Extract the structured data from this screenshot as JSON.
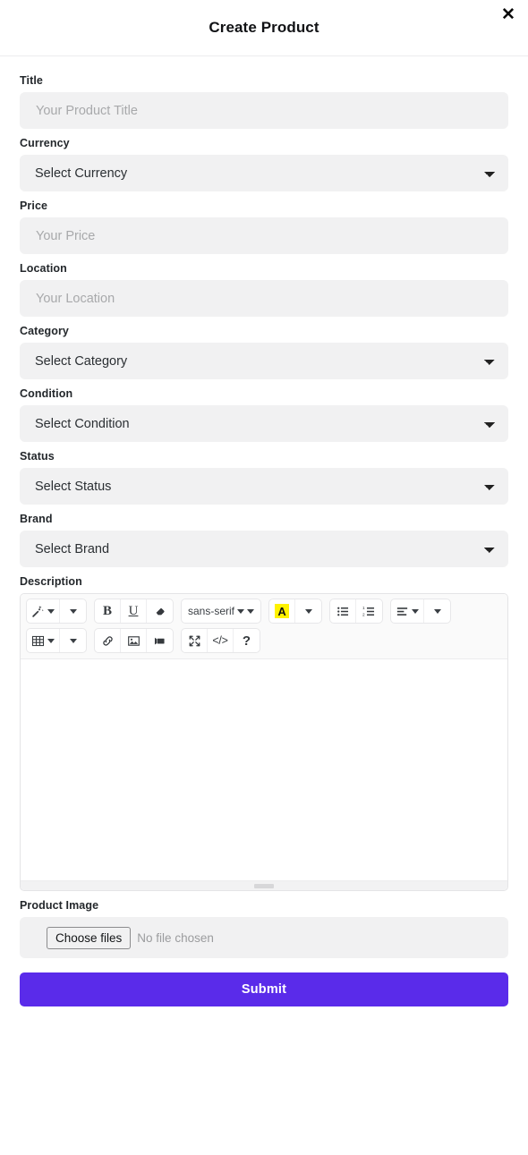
{
  "header": {
    "title": "Create Product",
    "close_label": "✕"
  },
  "form": {
    "fields": [
      {
        "label": "Title",
        "type": "text",
        "placeholder": "Your Product Title",
        "value": ""
      },
      {
        "label": "Currency",
        "type": "select",
        "selected": "Select Currency"
      },
      {
        "label": "Price",
        "type": "text",
        "placeholder": "Your Price",
        "value": ""
      },
      {
        "label": "Location",
        "type": "text",
        "placeholder": "Your Location",
        "value": ""
      },
      {
        "label": "Category",
        "type": "select",
        "selected": "Select Category"
      },
      {
        "label": "Condition",
        "type": "select",
        "selected": "Select Condition"
      },
      {
        "label": "Status",
        "type": "select",
        "selected": "Select Status"
      },
      {
        "label": "Brand",
        "type": "select",
        "selected": "Select Brand"
      }
    ],
    "description_label": "Description",
    "product_image_label": "Product Image"
  },
  "editor": {
    "toolbar": {
      "row1": [
        {
          "icon": "magic-wand-icon",
          "caret": true,
          "extra_caret": true
        },
        {
          "icon": "bold-icon",
          "text": "B"
        },
        {
          "icon": "underline-icon",
          "text": "U"
        },
        {
          "icon": "eraser-icon"
        },
        {
          "icon": "font-name-icon",
          "text": "sans-serif",
          "caret": true,
          "extra_caret": true
        },
        {
          "icon": "highlight-color-icon",
          "text": "A",
          "color": "#fff200",
          "caret": true
        },
        {
          "icon": "unordered-list-icon"
        },
        {
          "icon": "ordered-list-icon"
        },
        {
          "icon": "align-left-icon",
          "caret": true,
          "extra_caret": true
        }
      ],
      "row2": [
        {
          "icon": "table-icon",
          "caret": true,
          "extra_caret": true
        },
        {
          "icon": "link-icon"
        },
        {
          "icon": "picture-icon"
        },
        {
          "icon": "video-icon"
        },
        {
          "icon": "fullscreen-icon"
        },
        {
          "icon": "code-view-icon",
          "text": "</>"
        },
        {
          "icon": "help-icon",
          "text": "?"
        }
      ]
    },
    "content": ""
  },
  "file_upload": {
    "button_label": "Choose files",
    "status_text": "No file chosen"
  },
  "submit": {
    "label": "Submit"
  },
  "colors": {
    "accent": "#5a2bea",
    "field_bg": "#f1f1f2",
    "highlight": "#fff200",
    "text": "#212529"
  }
}
